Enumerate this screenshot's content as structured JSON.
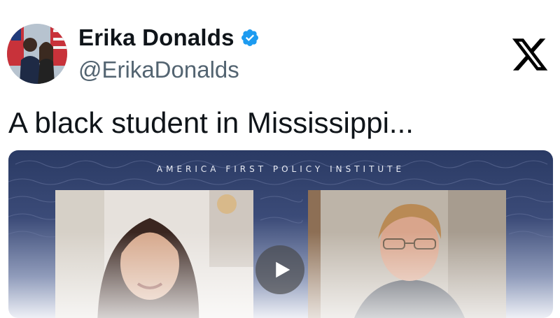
{
  "post": {
    "author": {
      "display_name": "Erika Donalds",
      "handle": "@ErikaDonalds",
      "verified": true,
      "avatar_icon": "profile-photo"
    },
    "platform_icon": "x-logo-icon",
    "text": "A black student in Mississippi...",
    "media": {
      "type": "video",
      "banner_text": "AMERICA FIRST POLICY INSTITUTE",
      "play_icon": "play-icon"
    }
  },
  "colors": {
    "verified_badge": "#1d9bf0",
    "text_primary": "#0f1419",
    "text_secondary": "#536471"
  }
}
